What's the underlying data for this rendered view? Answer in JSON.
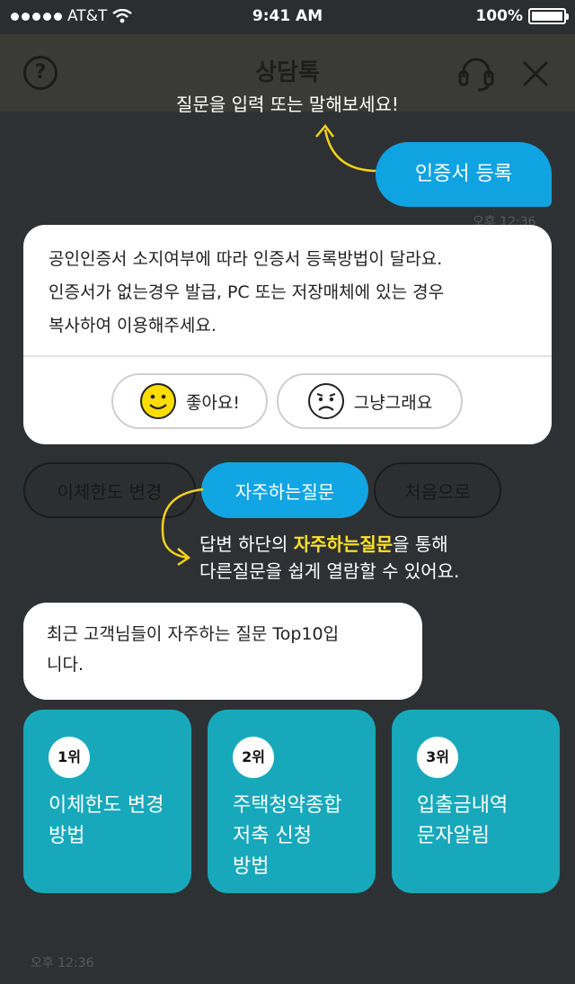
{
  "status_bar": {
    "carrier": "AT&T",
    "time": "9:41 AM",
    "battery": "100%"
  },
  "header": {
    "title": "상담톡"
  },
  "icons": {
    "help": "question-icon",
    "agent": "headset-icon",
    "close": "close-icon"
  },
  "hint_top": "질문을 입력 또는 말해보세요!",
  "user_message": {
    "text": "인증서 등록",
    "time": "오후 12:36"
  },
  "answer_card": {
    "lines": [
      "공인인증서 소지여부에 따라 인증서 등록방법이 달라요.",
      "인증서가 없는경우 발급, PC 또는 저장매체에 있는 경우",
      "복사하여 이용해주세요."
    ],
    "like_label": "좋아요!",
    "meh_label": "그냥그래요"
  },
  "quick_chips": [
    {
      "label": "이체한도 변경"
    },
    {
      "label": "자주하는질문"
    },
    {
      "label": "처음으로"
    }
  ],
  "hint_mid": {
    "line1_prefix": "답변 하단의 ",
    "line1_highlight": "자주하는질문",
    "line1_suffix": "을 통해",
    "line2": "다른질문을 쉽게 열람할 수 있어요."
  },
  "bot_message": {
    "line1": "최근 고객님들이 자주하는 질문 Top10입",
    "line2": "니다."
  },
  "top_questions": [
    {
      "rank": "1위",
      "line1": "이체한도 변경",
      "line2": "방법",
      "line3": ""
    },
    {
      "rank": "2위",
      "line1": "주택청약종합",
      "line2": "저축 신청",
      "line3": "방법"
    },
    {
      "rank": "3위",
      "line1": "입출금내역",
      "line2": "문자알림",
      "line3": ""
    }
  ],
  "bottom_time": "오후 12:36",
  "colors": {
    "accent": "#10a3e2",
    "tile": "#17a9bb",
    "highlight": "#ffe228",
    "background": "#2e3133"
  }
}
